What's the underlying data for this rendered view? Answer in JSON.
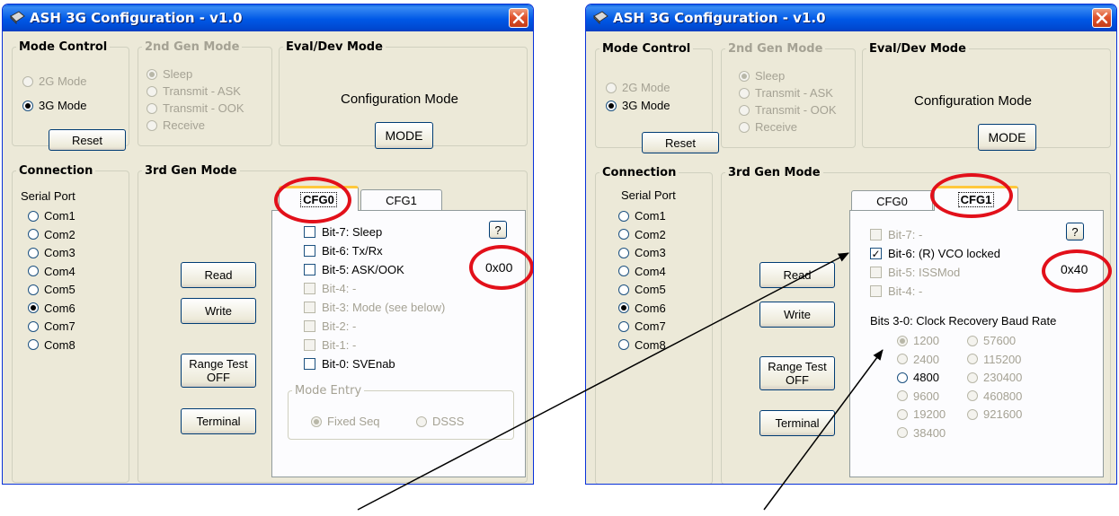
{
  "left": {
    "title": "ASH 3G Configuration - v1.0",
    "mode_control": {
      "legend": "Mode Control",
      "opt1": "2G Mode",
      "opt2": "3G Mode",
      "reset": "Reset"
    },
    "gen2": {
      "legend": "2nd Gen Mode",
      "opts": [
        "Sleep",
        "Transmit - ASK",
        "Transmit - OOK",
        "Receive"
      ]
    },
    "eval": {
      "legend": "Eval/Dev Mode",
      "label": "Configuration Mode",
      "button": "MODE"
    },
    "connection": {
      "legend": "Connection",
      "serial": "Serial Port",
      "ports": [
        "Com1",
        "Com2",
        "Com3",
        "Com4",
        "Com5",
        "Com6",
        "Com7",
        "Com8"
      ],
      "selected": "Com6"
    },
    "gen3": {
      "legend": "3rd Gen Mode",
      "read": "Read",
      "write": "Write",
      "range1": "Range Test",
      "range2": "OFF",
      "terminal": "Terminal"
    },
    "tabs": [
      "CFG0",
      "CFG1"
    ],
    "active_tab": "CFG0",
    "help": "?",
    "value": "0x00",
    "bits": [
      {
        "label": "Bit-7:  Sleep",
        "enabled": true,
        "checked": false
      },
      {
        "label": "Bit-6:  Tx/Rx",
        "enabled": true,
        "checked": false
      },
      {
        "label": "Bit-5:  ASK/OOK",
        "enabled": true,
        "checked": false
      },
      {
        "label": "Bit-4:  -",
        "enabled": false,
        "checked": false
      },
      {
        "label": "Bit-3:  Mode (see below)",
        "enabled": false,
        "checked": false
      },
      {
        "label": "Bit-2:  -",
        "enabled": false,
        "checked": false
      },
      {
        "label": "Bit-1:  -",
        "enabled": false,
        "checked": false
      },
      {
        "label": "Bit-0:  SVEnab",
        "enabled": true,
        "checked": false
      }
    ],
    "mode_entry": {
      "legend": "Mode Entry",
      "opt1": "Fixed Seq",
      "opt2": "DSSS"
    }
  },
  "right": {
    "title": "ASH 3G Configuration - v1.0",
    "mode_control": {
      "legend": "Mode Control",
      "opt1": "2G Mode",
      "opt2": "3G Mode",
      "reset": "Reset"
    },
    "gen2": {
      "legend": "2nd Gen Mode",
      "opts": [
        "Sleep",
        "Transmit - ASK",
        "Transmit - OOK",
        "Receive"
      ]
    },
    "eval": {
      "legend": "Eval/Dev Mode",
      "label": "Configuration Mode",
      "button": "MODE"
    },
    "connection": {
      "legend": "Connection",
      "serial": "Serial Port",
      "ports": [
        "Com1",
        "Com2",
        "Com3",
        "Com4",
        "Com5",
        "Com6",
        "Com7",
        "Com8"
      ],
      "selected": "Com6"
    },
    "gen3": {
      "legend": "3rd Gen Mode",
      "read": "Read",
      "write": "Write",
      "range1": "Range Test",
      "range2": "OFF",
      "terminal": "Terminal"
    },
    "tabs": [
      "CFG0",
      "CFG1"
    ],
    "active_tab": "CFG1",
    "help": "?",
    "value": "0x40",
    "bits": [
      {
        "label": "Bit-7:  -",
        "enabled": false,
        "checked": false
      },
      {
        "label": "Bit-6:  (R) VCO locked",
        "enabled": true,
        "checked": true
      },
      {
        "label": "Bit-5:  ISSMod",
        "enabled": false,
        "checked": false
      },
      {
        "label": "Bit-4:  -",
        "enabled": false,
        "checked": false
      }
    ],
    "baud_title": "Bits 3-0:  Clock Recovery Baud Rate",
    "baud_col1": [
      "1200",
      "2400",
      "4800",
      "9600",
      "19200",
      "38400"
    ],
    "baud_col2": [
      "57600",
      "115200",
      "230400",
      "460800",
      "921600"
    ],
    "baud_selected": "1200"
  }
}
